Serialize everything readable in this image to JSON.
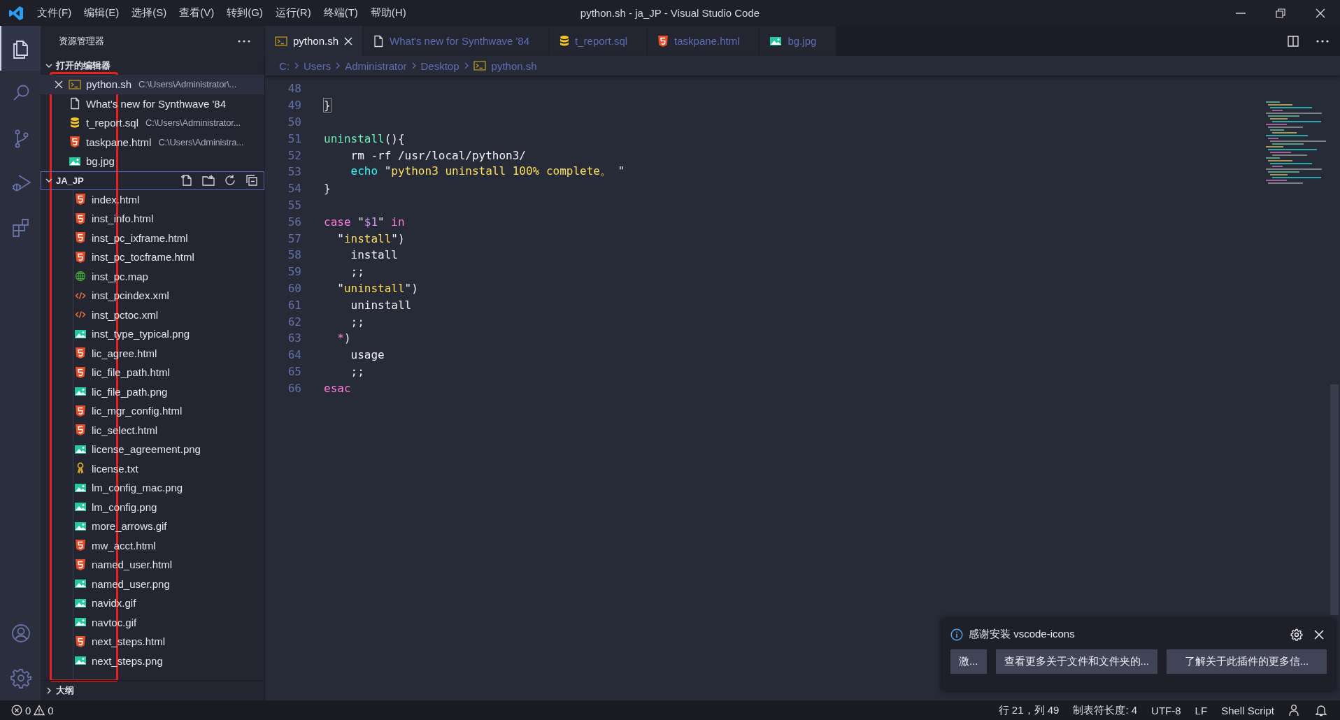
{
  "window": {
    "title": "python.sh - ja_JP - Visual Studio Code"
  },
  "menu": [
    "文件(F)",
    "编辑(E)",
    "选择(S)",
    "查看(V)",
    "转到(G)",
    "运行(R)",
    "终端(T)",
    "帮助(H)"
  ],
  "activity_bar": [
    {
      "kind": "explorer",
      "selected": true
    },
    {
      "kind": "search",
      "selected": false
    },
    {
      "kind": "source-control",
      "selected": false
    },
    {
      "kind": "run",
      "selected": false
    },
    {
      "kind": "extensions",
      "selected": false
    },
    {
      "kind": "account",
      "selected": false
    },
    {
      "kind": "settings",
      "selected": false
    }
  ],
  "sidebar": {
    "title": "资源管理器",
    "open_editors": {
      "title": "打开的编辑器",
      "expanded": true,
      "items": [
        {
          "name": "python.sh",
          "path": "C:\\Users\\Administrator\\...",
          "kind": "shell",
          "selected": true
        },
        {
          "name": "What's new for Synthwave '84",
          "kind": "doc",
          "selected": false
        },
        {
          "name": "t_report.sql",
          "path": "C:\\Users\\Administrator...",
          "kind": "sql",
          "selected": false
        },
        {
          "name": "taskpane.html",
          "path": "C:\\Users\\Administra...",
          "kind": "html",
          "selected": false
        },
        {
          "name": "bg.jpg",
          "kind": "image",
          "selected": false
        }
      ]
    },
    "folder": {
      "title": "JA_JP",
      "expanded": true,
      "focused": true,
      "items": [
        {
          "name": "index.html",
          "kind": "html"
        },
        {
          "name": "inst_info.html",
          "kind": "html"
        },
        {
          "name": "inst_pc_ixframe.html",
          "kind": "html"
        },
        {
          "name": "inst_pc_tocframe.html",
          "kind": "html"
        },
        {
          "name": "inst_pc.map",
          "kind": "map"
        },
        {
          "name": "inst_pcindex.xml",
          "kind": "xml"
        },
        {
          "name": "inst_pctoc.xml",
          "kind": "xml"
        },
        {
          "name": "inst_type_typical.png",
          "kind": "image"
        },
        {
          "name": "lic_agree.html",
          "kind": "html"
        },
        {
          "name": "lic_file_path.html",
          "kind": "html"
        },
        {
          "name": "lic_file_path.png",
          "kind": "image"
        },
        {
          "name": "lic_mgr_config.html",
          "kind": "html"
        },
        {
          "name": "lic_select.html",
          "kind": "html"
        },
        {
          "name": "license_agreement.png",
          "kind": "image"
        },
        {
          "name": "license.txt",
          "kind": "license"
        },
        {
          "name": "lm_config_mac.png",
          "kind": "image"
        },
        {
          "name": "lm_config.png",
          "kind": "image"
        },
        {
          "name": "more_arrows.gif",
          "kind": "image"
        },
        {
          "name": "mw_acct.html",
          "kind": "html"
        },
        {
          "name": "named_user.html",
          "kind": "html"
        },
        {
          "name": "named_user.png",
          "kind": "image"
        },
        {
          "name": "navidx.gif",
          "kind": "image"
        },
        {
          "name": "navtoc.gif",
          "kind": "image"
        },
        {
          "name": "next_steps.html",
          "kind": "html"
        },
        {
          "name": "next_steps.png",
          "kind": "image"
        }
      ]
    },
    "outline": {
      "title": "大纲",
      "expanded": false
    }
  },
  "tabs": [
    {
      "label": "python.sh",
      "kind": "shell",
      "selected": true
    },
    {
      "label": "What's new for Synthwave '84",
      "kind": "doc",
      "selected": false
    },
    {
      "label": "t_report.sql",
      "kind": "sql",
      "selected": false
    },
    {
      "label": "taskpane.html",
      "kind": "html",
      "selected": false
    },
    {
      "label": "bg.jpg",
      "kind": "image",
      "selected": false
    }
  ],
  "breadcrumb": [
    {
      "label": "C:"
    },
    {
      "label": "Users"
    },
    {
      "label": "Administrator"
    },
    {
      "label": "Desktop"
    },
    {
      "label": "python.sh",
      "kind": "shell"
    }
  ],
  "editor": {
    "lines": [
      {
        "number": "48"
      },
      {
        "number": "49",
        "tokens": [
          {
            "text": "}",
            "kind": "bracket-match"
          }
        ]
      },
      {
        "number": "50"
      },
      {
        "number": "51",
        "tokens": [
          {
            "text": "uninstall",
            "kind": "func"
          },
          {
            "text": "(){",
            "kind": "plain"
          }
        ]
      },
      {
        "number": "52",
        "tokens": [
          {
            "text": "    rm -rf /usr/local/python3/",
            "kind": "plain"
          }
        ]
      },
      {
        "number": "53",
        "tokens": [
          {
            "text": "    echo",
            "kind": "builtin"
          },
          {
            "text": " \"",
            "kind": "plain"
          },
          {
            "text": "python3 uninstall 100% complete。 ",
            "kind": "string"
          },
          {
            "text": "\"",
            "kind": "plain"
          }
        ]
      },
      {
        "number": "54",
        "tokens": [
          {
            "text": "}",
            "kind": "plain"
          }
        ]
      },
      {
        "number": "55"
      },
      {
        "number": "56",
        "tokens": [
          {
            "text": "case",
            "kind": "keyword"
          },
          {
            "text": " \"",
            "kind": "plain"
          },
          {
            "text": "$1",
            "kind": "var"
          },
          {
            "text": "\" ",
            "kind": "plain"
          },
          {
            "text": "in",
            "kind": "keyword"
          }
        ]
      },
      {
        "number": "57",
        "tokens": [
          {
            "text": "  \"",
            "kind": "plain"
          },
          {
            "text": "install",
            "kind": "string"
          },
          {
            "text": "\")",
            "kind": "plain"
          }
        ]
      },
      {
        "number": "58",
        "tokens": [
          {
            "text": "    install",
            "kind": "plain"
          }
        ]
      },
      {
        "number": "59",
        "tokens": [
          {
            "text": "    ;;",
            "kind": "plain"
          }
        ]
      },
      {
        "number": "60",
        "tokens": [
          {
            "text": "  \"",
            "kind": "plain"
          },
          {
            "text": "uninstall",
            "kind": "string"
          },
          {
            "text": "\")",
            "kind": "plain"
          }
        ]
      },
      {
        "number": "61",
        "tokens": [
          {
            "text": "    uninstall",
            "kind": "plain"
          }
        ]
      },
      {
        "number": "62",
        "tokens": [
          {
            "text": "    ;;",
            "kind": "plain"
          }
        ]
      },
      {
        "number": "63",
        "tokens": [
          {
            "text": "  *",
            "kind": "keyword"
          },
          {
            "text": ")",
            "kind": "plain"
          }
        ]
      },
      {
        "number": "64",
        "tokens": [
          {
            "text": "    usage",
            "kind": "plain"
          }
        ]
      },
      {
        "number": "65",
        "tokens": [
          {
            "text": "    ;;",
            "kind": "plain"
          }
        ]
      },
      {
        "number": "66",
        "tokens": [
          {
            "text": "esac",
            "kind": "keyword"
          }
        ]
      }
    ]
  },
  "notification": {
    "message": "感谢安装 vscode-icons",
    "buttons": [
      "激...",
      "查看更多关于文件和文件夹的...",
      "了解关于此插件的更多信..."
    ]
  },
  "status_bar": {
    "errors": "0",
    "warnings": "0",
    "items": [
      "行 21，列 49",
      "制表符长度: 4",
      "UTF-8",
      "LF",
      "Shell Script"
    ]
  },
  "annotation": {
    "kind": "rectangle"
  }
}
